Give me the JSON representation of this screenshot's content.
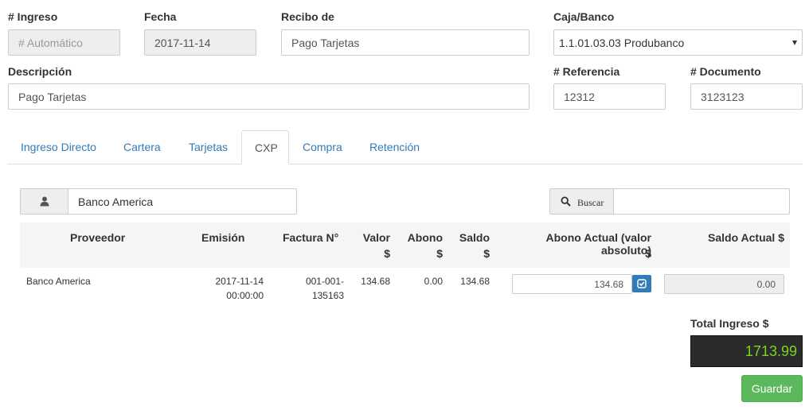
{
  "form": {
    "ingreso_label": "# Ingreso",
    "ingreso_placeholder": "# Automático",
    "fecha_label": "Fecha",
    "fecha_value": "2017-11-14",
    "recibo_label": "Recibo de",
    "recibo_value": "Pago Tarjetas",
    "caja_label": "Caja/Banco",
    "caja_value": "1.1.01.03.03 Produbanco",
    "descripcion_label": "Descripción",
    "descripcion_value": "Pago Tarjetas",
    "referencia_label": "# Referencia",
    "referencia_value": "12312",
    "documento_label": "# Documento",
    "documento_value": "3123123"
  },
  "tabs": [
    {
      "label": "Ingreso Directo"
    },
    {
      "label": "Cartera"
    },
    {
      "label": "Tarjetas"
    },
    {
      "label": "CXP"
    },
    {
      "label": "Compra"
    },
    {
      "label": "Retención"
    }
  ],
  "cxp": {
    "proveedor_value": "Banco America",
    "search_label": "Buscar",
    "search_value": "",
    "headers": {
      "proveedor": "Proveedor",
      "emision": "Emisión",
      "factura": "Factura N°",
      "valor": "Valor",
      "valor_unit": "$",
      "abono": "Abono",
      "abono_unit": "$",
      "saldo": "Saldo",
      "saldo_unit": "$",
      "abono_actual": "Abono Actual (valor absoluto)",
      "abono_actual_unit": "$",
      "saldo_actual": "Saldo Actual $"
    },
    "rows": [
      {
        "proveedor": "Banco America",
        "emision_date": "2017-11-14",
        "emision_time": "00:00:00",
        "factura_1": "001-001-",
        "factura_2": "135163",
        "valor": "134.68",
        "abono": "0.00",
        "saldo": "134.68",
        "abono_actual": "134.68",
        "saldo_actual": "0.00"
      }
    ]
  },
  "total": {
    "label": "Total Ingreso $",
    "value": "1713.99",
    "value_color": "#7ed321"
  },
  "save_label": "Guardar",
  "icons": {
    "user": "user-icon",
    "search": "search-icon",
    "check": "check-square-icon"
  }
}
